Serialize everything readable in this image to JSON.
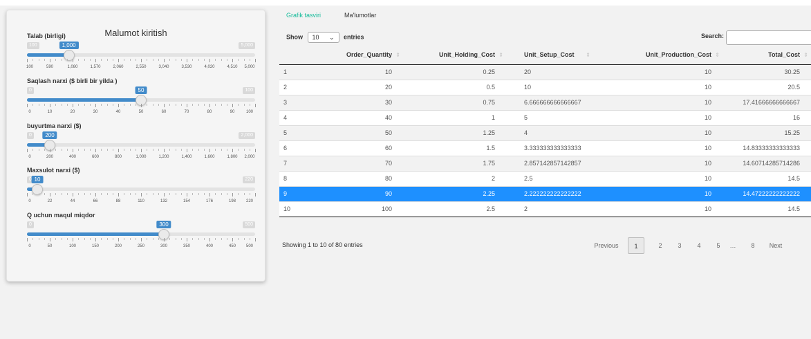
{
  "sidebar": {
    "title": "Malumot kiritish",
    "sliders": [
      {
        "label": "Talab (birligi)",
        "min": "100",
        "max": "5,000",
        "value": "1,000",
        "fraction": 0.1837,
        "ticks": [
          "100",
          "590",
          "1,080",
          "1,570",
          "2,060",
          "2,550",
          "3,040",
          "3,530",
          "4,020",
          "4,510",
          "5,000"
        ]
      },
      {
        "label": "Saqlash narxi ($ birli bir yilda )",
        "min": "0",
        "max": "100",
        "value": "50",
        "fraction": 0.5,
        "ticks": [
          "0",
          "10",
          "20",
          "30",
          "40",
          "50",
          "60",
          "70",
          "80",
          "90",
          "100"
        ]
      },
      {
        "label": "buyurtma narxi ($)",
        "min": "0",
        "max": "2,000",
        "value": "200",
        "fraction": 0.1,
        "ticks": [
          "0",
          "200",
          "400",
          "600",
          "800",
          "1,000",
          "1,200",
          "1,400",
          "1,600",
          "1,800",
          "2,000"
        ]
      },
      {
        "label": "Maxsulot narxi ($)",
        "min": "0",
        "max": "220",
        "value": "10",
        "fraction": 0.0455,
        "ticks": [
          "0",
          "22",
          "44",
          "66",
          "88",
          "110",
          "132",
          "154",
          "176",
          "198",
          "220"
        ]
      },
      {
        "label": "Q uchun maqul miqdor",
        "min": "0",
        "max": "500",
        "value": "300",
        "fraction": 0.6,
        "ticks": [
          "0",
          "50",
          "100",
          "150",
          "200",
          "250",
          "300",
          "350",
          "400",
          "450",
          "500"
        ]
      }
    ]
  },
  "tabs": [
    {
      "label": "Grafik tasviri",
      "active": true
    },
    {
      "label": "Ma'lumotlar",
      "active": false
    }
  ],
  "controls": {
    "show_label": "Show",
    "page_length": "10",
    "entries_label": "entries",
    "search_label": "Search:"
  },
  "table": {
    "columns": [
      "",
      "Order_Quantity",
      "Unit_Holding_Cost",
      "Unit_Setup_Cost",
      "Unit_Production_Cost",
      "Total_Cost"
    ],
    "rows": [
      [
        "1",
        "10",
        "0.25",
        "20",
        "10",
        "30.25"
      ],
      [
        "2",
        "20",
        "0.5",
        "10",
        "10",
        "20.5"
      ],
      [
        "3",
        "30",
        "0.75",
        "6.666666666666667",
        "10",
        "17.41666666666667"
      ],
      [
        "4",
        "40",
        "1",
        "5",
        "10",
        "16"
      ],
      [
        "5",
        "50",
        "1.25",
        "4",
        "10",
        "15.25"
      ],
      [
        "6",
        "60",
        "1.5",
        "3.333333333333333",
        "10",
        "14.83333333333333"
      ],
      [
        "7",
        "70",
        "1.75",
        "2.857142857142857",
        "10",
        "14.60714285714286"
      ],
      [
        "8",
        "80",
        "2",
        "2.5",
        "10",
        "14.5"
      ],
      [
        "9",
        "90",
        "2.25",
        "2.222222222222222",
        "10",
        "14.47222222222222"
      ],
      [
        "10",
        "100",
        "2.5",
        "2",
        "10",
        "14.5"
      ]
    ],
    "selected_row_index": 8
  },
  "footer": {
    "info": "Showing 1 to 10 of 80 entries",
    "pagination": [
      "Previous",
      "1",
      "2",
      "3",
      "4",
      "5",
      "…",
      "8",
      "Next"
    ],
    "current_page": "1"
  },
  "colors": {
    "accent": "#428bca",
    "tab_active": "#18bc9c",
    "selected_row": "#1e90ff"
  }
}
